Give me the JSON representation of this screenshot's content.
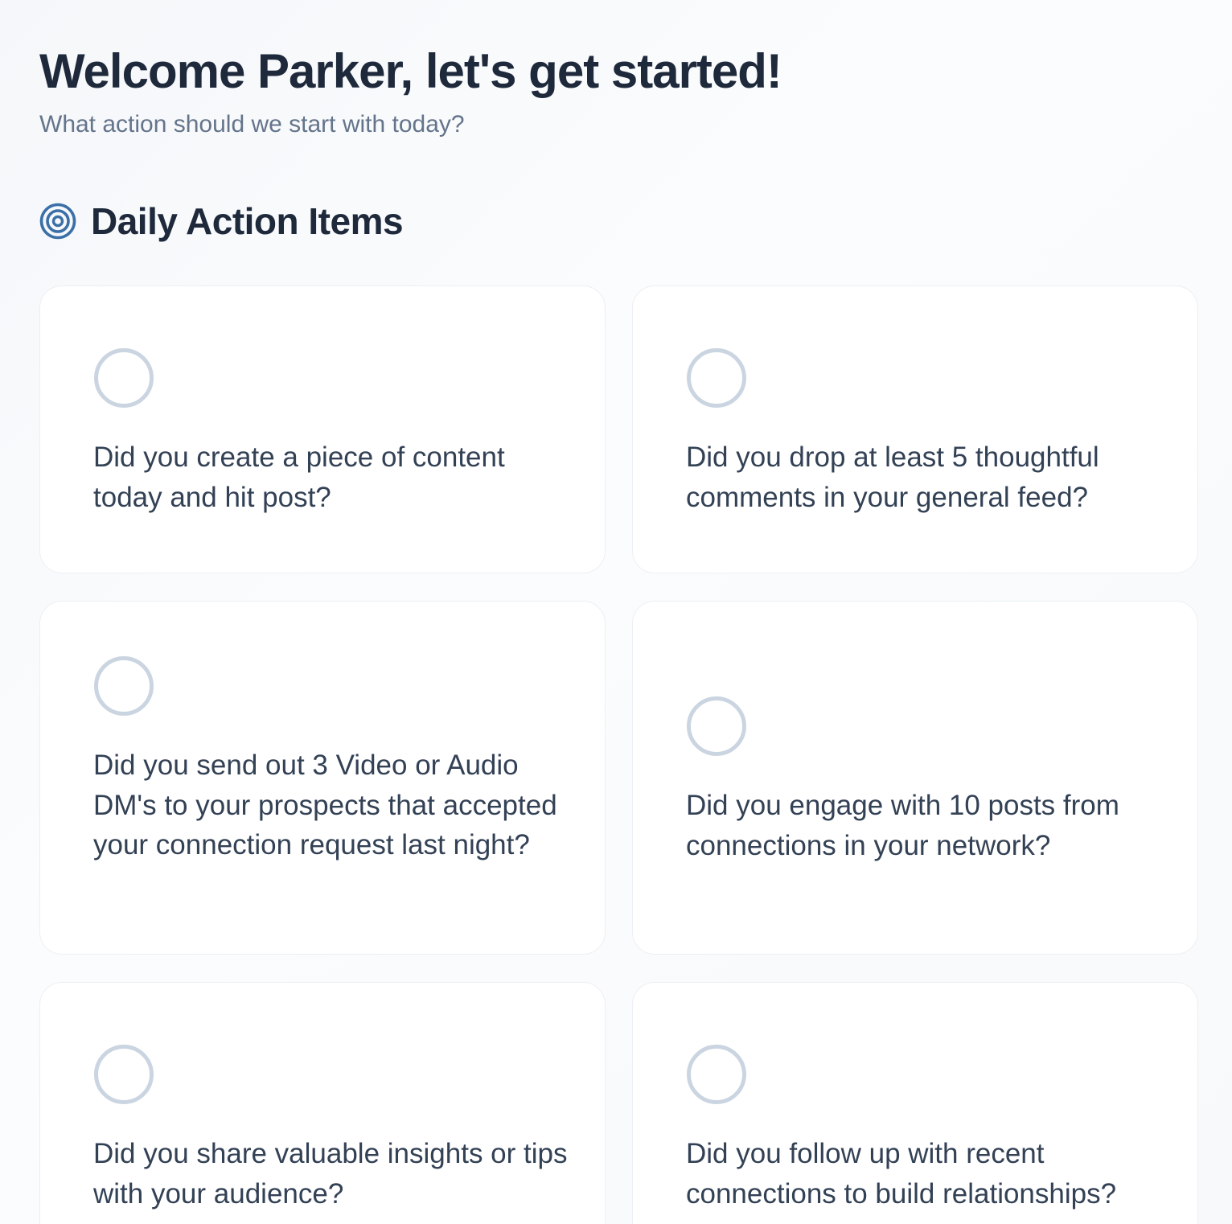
{
  "header": {
    "title": "Welcome Parker, let's get started!",
    "subtitle": "What action should we start with today?"
  },
  "section": {
    "icon": "target-icon",
    "title": "Daily Action Items"
  },
  "colors": {
    "heading": "#1e293b",
    "muted": "#64748b",
    "accent": "#3b6fa8",
    "check_border": "#cbd5e1"
  },
  "action_items": [
    {
      "question": "Did you create a piece of content today and hit post?",
      "checked": false
    },
    {
      "question": "Did you drop at least 5 thoughtful comments in your general feed?",
      "checked": false
    },
    {
      "question": "Did you send out 3 Video or Audio DM's to your prospects that accepted your connection request last night?",
      "checked": false
    },
    {
      "question": "Did you engage with 10 posts from connections in your network?",
      "checked": false
    },
    {
      "question": "Did you share valuable insights or tips with your audience?",
      "checked": false
    },
    {
      "question": "Did you follow up with recent connections to build relationships?",
      "checked": false
    }
  ]
}
